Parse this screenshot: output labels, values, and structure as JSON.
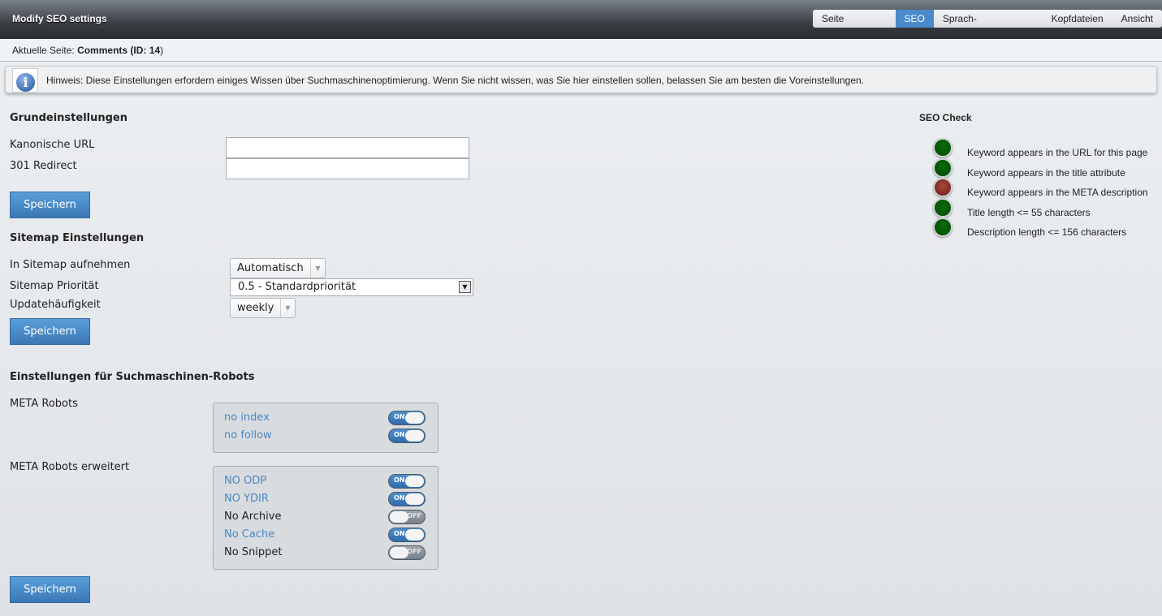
{
  "header": {
    "title": "Modify SEO settings",
    "tabs": [
      {
        "label": "Seite bearbeiten",
        "active": false
      },
      {
        "label": "SEO",
        "active": true
      },
      {
        "label": "Sprach-Verknüpfungen",
        "active": false
      },
      {
        "label": "Kopfdateien",
        "active": false
      },
      {
        "label": "Ansicht",
        "active": false
      }
    ]
  },
  "breadcrumb": {
    "prefix": "Aktuelle Seite:",
    "page": "Comments",
    "id_label": "(ID:",
    "id": "14",
    "close": ")"
  },
  "notice": {
    "icon": "info-icon",
    "text": "Hinweis: Diese Einstellungen erfordern einiges Wissen über Suchmaschinenoptimierung. Wenn Sie nicht wissen, was Sie hier einstellen sollen, belassen Sie am besten die Voreinstellungen."
  },
  "basic": {
    "heading": "Grundeinstellungen",
    "canonical_label": "Kanonische URL",
    "canonical_value": "",
    "redirect_label": "301 Redirect",
    "redirect_value": "",
    "save": "Speichern"
  },
  "sitemap": {
    "heading": "Sitemap Einstellungen",
    "include_label": "In Sitemap aufnehmen",
    "include_value": "Automatisch",
    "priority_label": "Sitemap Priorität",
    "priority_value": "0.5 - Standardpriorität",
    "freq_label": "Updatehäufigkeit",
    "freq_value": "weekly",
    "save": "Speichern"
  },
  "robots": {
    "heading": "Einstellungen für Suchmaschinen-Robots",
    "meta_label": "META Robots",
    "meta": [
      {
        "label": "no index",
        "on": true
      },
      {
        "label": "no follow",
        "on": true
      }
    ],
    "ext_label": "META Robots erweitert",
    "ext": [
      {
        "label": "NO ODP",
        "on": true
      },
      {
        "label": "NO YDIR",
        "on": true
      },
      {
        "label": "No Archive",
        "on": false
      },
      {
        "label": "No Cache",
        "on": true
      },
      {
        "label": "No Snippet",
        "on": false
      }
    ],
    "on_text": "ON",
    "off_text": "OFF",
    "save": "Speichern"
  },
  "seo_check": {
    "heading": "SEO Check",
    "colors": {
      "pass": "#005500",
      "fail": "#8b2e24"
    },
    "items": [
      {
        "text": "Keyword appears in the URL for this page",
        "status": "pass"
      },
      {
        "text": "Keyword appears in the title attribute",
        "status": "pass"
      },
      {
        "text": "Keyword appears in the META description",
        "status": "fail"
      },
      {
        "text": "Title length <= 55 characters",
        "status": "pass"
      },
      {
        "text": "Description length <= 156 characters",
        "status": "pass"
      }
    ]
  }
}
